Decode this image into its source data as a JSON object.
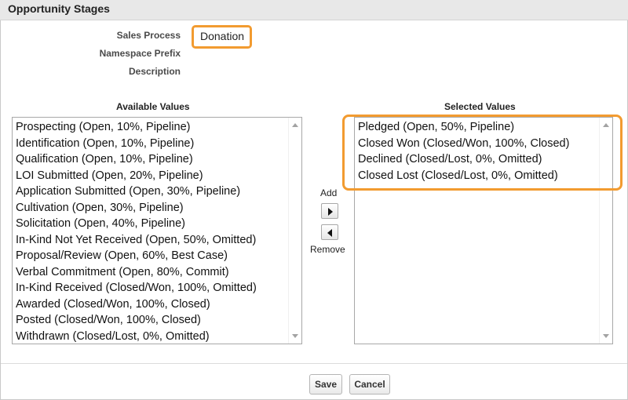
{
  "header": {
    "title": "Opportunity Stages"
  },
  "fields": {
    "sales_process": {
      "label": "Sales Process",
      "value": "Donation"
    },
    "namespace_prefix": {
      "label": "Namespace Prefix"
    },
    "description": {
      "label": "Description"
    }
  },
  "available": {
    "title": "Available Values",
    "items": [
      "Prospecting (Open, 10%, Pipeline)",
      "Identification (Open, 10%, Pipeline)",
      "Qualification (Open, 10%, Pipeline)",
      "LOI Submitted (Open, 20%, Pipeline)",
      "Application Submitted (Open, 30%, Pipeline)",
      "Cultivation (Open, 30%, Pipeline)",
      "Solicitation (Open, 40%, Pipeline)",
      "In-Kind Not Yet Received (Open, 50%, Omitted)",
      "Proposal/Review (Open, 60%, Best Case)",
      "Verbal Commitment (Open, 80%, Commit)",
      "In-Kind Received (Closed/Won, 100%, Omitted)",
      "Awarded (Closed/Won, 100%, Closed)",
      "Posted (Closed/Won, 100%, Closed)",
      "Withdrawn (Closed/Lost, 0%, Omitted)"
    ]
  },
  "selected": {
    "title": "Selected Values",
    "items": [
      "Pledged (Open, 50%, Pipeline)",
      "Closed Won (Closed/Won, 100%, Closed)",
      "Declined (Closed/Lost, 0%, Omitted)",
      "Closed Lost (Closed/Lost, 0%, Omitted)"
    ]
  },
  "mover": {
    "add_label": "Add",
    "remove_label": "Remove"
  },
  "buttons": {
    "save": "Save",
    "cancel": "Cancel"
  },
  "colors": {
    "highlight": "#f29b30",
    "header_bg": "#e8e8e8"
  }
}
